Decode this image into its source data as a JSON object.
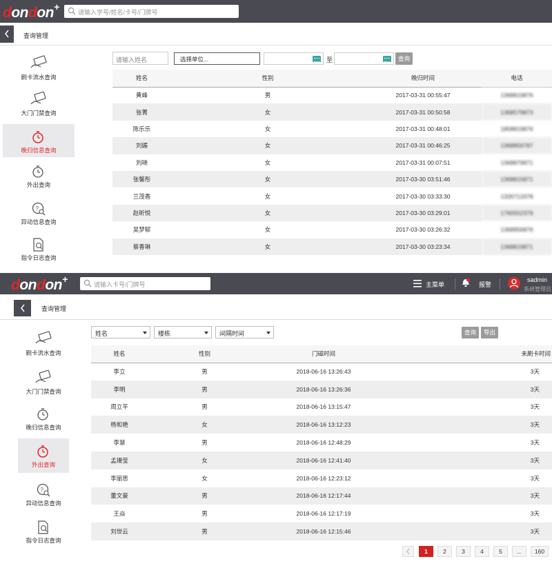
{
  "shot1": {
    "logo": {
      "d1": "d",
      "on1": "on",
      "d2": "d",
      "on2": "on",
      "plus": "+"
    },
    "search_placeholder": "请输入学号/姓名/卡号/门牌号",
    "breadcrumb": "查询管理",
    "nav": [
      {
        "label": "刷卡流水查询",
        "icon": "card-swipe-icon",
        "active": false
      },
      {
        "label": "大门门禁查询",
        "icon": "gate-card-icon",
        "active": false
      },
      {
        "label": "晚归信息查询",
        "icon": "late-return-clock-icon",
        "active": true
      },
      {
        "label": "外出查询",
        "icon": "outing-clock-icon",
        "active": false
      },
      {
        "label": "异动信息查询",
        "icon": "anomaly-search-icon",
        "active": false
      },
      {
        "label": "指令日志查询",
        "icon": "command-log-icon",
        "active": false
      }
    ],
    "filter": {
      "name_placeholder": "请输入姓名",
      "unit_button": "选择单位...",
      "to_label": "至",
      "query_button": "查询"
    },
    "columns": [
      "姓名",
      "性别",
      "晚归时间",
      "电话"
    ],
    "rows": [
      [
        "黄峰",
        "男",
        "2017-03-31 00:55:47",
        "1368819876"
      ],
      [
        "张菁",
        "女",
        "2017-03-31 00:50:58",
        "1368579873"
      ],
      [
        "陈乐乐",
        "女",
        "2017-03-31 00:48:01",
        "1858819876"
      ],
      [
        "刘媚",
        "女",
        "2017-03-31 00:46:25",
        "1368856787"
      ],
      [
        "刘晓",
        "女",
        "2017-03-31 00:07:51",
        "1368879871"
      ],
      [
        "张馨彤",
        "女",
        "2017-03-30 03:51:46",
        "1368815871"
      ],
      [
        "兰茂香",
        "女",
        "2017-03-30 03:33:30",
        "1326713378"
      ],
      [
        "赵昕悦",
        "女",
        "2017-03-30 03:29:01",
        "1760552379"
      ],
      [
        "吴梦郁",
        "女",
        "2017-03-30 03:26:32",
        "1368956876"
      ],
      [
        "蔡香琳",
        "女",
        "2017-03-30 03:23:34",
        "1368819871"
      ]
    ]
  },
  "shot2": {
    "logo": {
      "d1": "d",
      "on1": "on",
      "d2": "d",
      "on2": "on",
      "plus": "+"
    },
    "search_placeholder": "请输入卡号/门牌号",
    "main_menu": "主菜单",
    "alarm": "报警",
    "user_name": "sadmin",
    "user_role": "系统管理员",
    "breadcrumb": "查询管理",
    "nav": [
      {
        "label": "刷卡流水查询",
        "icon": "card-swipe-icon",
        "active": false
      },
      {
        "label": "大门门禁查询",
        "icon": "gate-card-icon",
        "active": false
      },
      {
        "label": "晚归信息查询",
        "icon": "late-return-clock-icon",
        "active": false
      },
      {
        "label": "外出查询",
        "icon": "outing-clock-icon",
        "active": true
      },
      {
        "label": "异动信息查询",
        "icon": "anomaly-search-icon",
        "active": false
      },
      {
        "label": "指令日志查询",
        "icon": "command-log-icon",
        "active": false
      }
    ],
    "filter": {
      "select_name": "姓名",
      "select_building": "楼栋",
      "select_interval": "间隔时间",
      "query_button": "查询",
      "export_button": "导出"
    },
    "columns": [
      "姓名",
      "性别",
      "门磁时间",
      "未刷卡时间"
    ],
    "rows": [
      [
        "李立",
        "男",
        "2018-06-16 13:26:43",
        "3天"
      ],
      [
        "李明",
        "男",
        "2018-06-16 13:26:36",
        "3天"
      ],
      [
        "周立平",
        "男",
        "2018-06-16 13:15:47",
        "3天"
      ],
      [
        "杨和艳",
        "女",
        "2018-06-16 13:12:23",
        "3天"
      ],
      [
        "李慧",
        "男",
        "2018-06-16 12:48:29",
        "3天"
      ],
      [
        "孟珊莹",
        "女",
        "2018-06-16 12:41:40",
        "3天"
      ],
      [
        "李丽思",
        "女",
        "2018-06-16 12:23:12",
        "3天"
      ],
      [
        "董文豪",
        "男",
        "2018-06-16 12:17:44",
        "3天"
      ],
      [
        "王焱",
        "男",
        "2018-06-16 12:17:19",
        "3天"
      ],
      [
        "刘世云",
        "男",
        "2018-06-16 12:15:46",
        "3天"
      ]
    ],
    "pager": [
      "1",
      "2",
      "3",
      "4",
      "5",
      "...",
      "160"
    ],
    "pager_active": "1"
  },
  "colors": {
    "topbar": "#4a4a52",
    "brand_red": "#e02828",
    "row_alt": "#eeeeee"
  }
}
